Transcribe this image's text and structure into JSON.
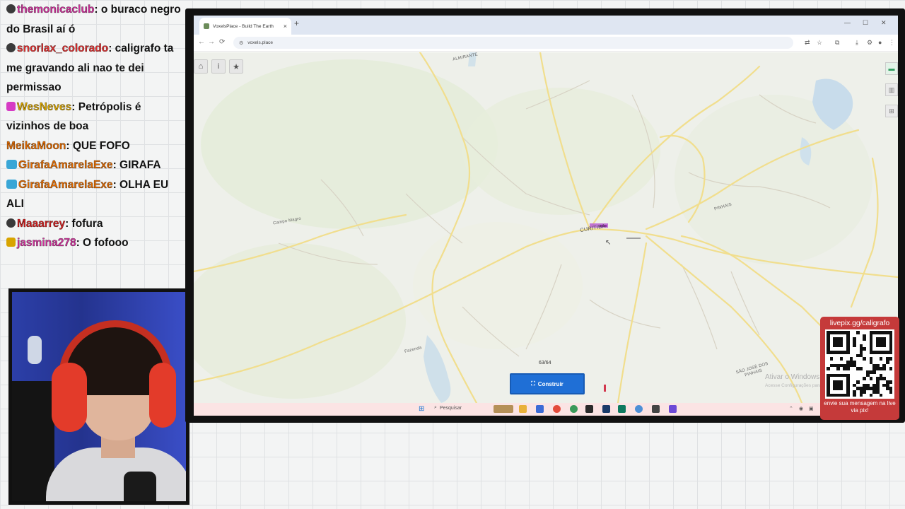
{
  "chat": [
    {
      "user": "themonicaclub",
      "user_color": "#d0309b",
      "badge": "",
      "message": ": o buraco negro do Brasil aí ó"
    },
    {
      "user": "snorlax_colorado",
      "user_color": "#e03030",
      "badge": "",
      "message": ": caligrafo ta me gravando ali nao te dei permissao"
    },
    {
      "user": "WesNeves",
      "user_color": "#d8a400",
      "badge": "pink",
      "message": ": Petrópolis é vizinhos de boa"
    },
    {
      "user": "MeikaMoon",
      "user_color": "#e06a00",
      "badge": "none",
      "message": ": QUE FOFO"
    },
    {
      "user": "GirafaAmarelaExe",
      "user_color": "#e06a00",
      "badge": "blue",
      "message": ": GIRAFA"
    },
    {
      "user": "GirafaAmarelaExe",
      "user_color": "#e06a00",
      "badge": "blue",
      "message": ": OLHA EU ALI"
    },
    {
      "user": "Maaarrey",
      "user_color": "#d01e1e",
      "badge": "",
      "message": ": fofura"
    },
    {
      "user": "jasmina278",
      "user_color": "#d0309b",
      "badge": "yel",
      "message": ": O fofooo"
    }
  ],
  "browser": {
    "tab_title": "VoxelsPlace - Build The Earth",
    "tab_close": "×",
    "new_tab": "+",
    "url": "voxels.place",
    "back": "←",
    "forward": "→",
    "reload": "⟳",
    "site_info": "⚙",
    "min": "—",
    "max": "☐",
    "close": "✕"
  },
  "map": {
    "labels": {
      "city": "CURITIBA",
      "pinhais": "PINHAIS",
      "sjp": "SÃO JOSÉ DOS PINHAIS",
      "almirante": "ALMIRANTE",
      "campo_magro": "Campo Magro",
      "fazenda": "Fazenda",
      "sub": "·"
    },
    "counter": "63/64",
    "build_button": "Construir",
    "watermark": "Ativar o Windows",
    "watermark_sub": "Acesse Configurações para ativar o Windows."
  },
  "taskbar": {
    "search": "Pesquisar"
  },
  "livepix": {
    "url": "livepix.gg/caligrafo",
    "message": "envie sua mensagem na live via pix!"
  },
  "colors": {
    "build_button": "#1f6fd6",
    "livepix_bg": "#c53a3a",
    "road_major": "#f2dc86",
    "road_minor": "#d9d4c6",
    "water": "#c5dcea",
    "park": "#dfe9cf"
  }
}
